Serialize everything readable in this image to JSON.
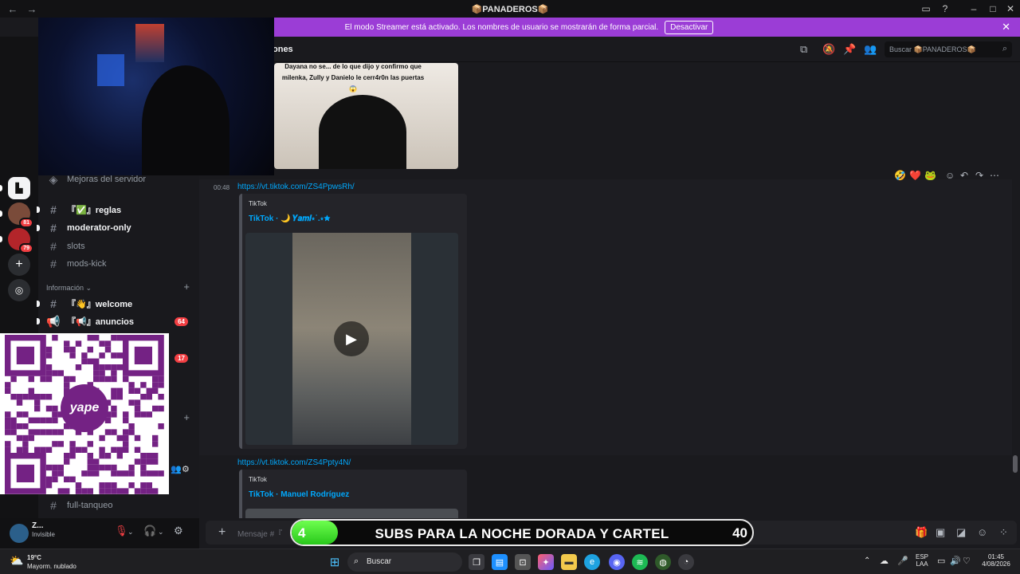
{
  "window": {
    "title": "📦PANADEROS📦",
    "back_icon": "←",
    "forward_icon": "→"
  },
  "banner": {
    "text": "El modo Streamer está activado. Los nombres de usuario se mostrarán de forma parcial.",
    "button": "Desactivar"
  },
  "header": {
    "title": "ones",
    "search_placeholder": "Buscar 📦PANADEROS📦"
  },
  "rail": {
    "badges": [
      "81",
      "79"
    ]
  },
  "sidebar": {
    "boosts": "Mejoras del servidor",
    "channels_top": [
      {
        "label": "『✅』reglas",
        "unread": true
      },
      {
        "label": "moderator-only",
        "unread": true
      },
      {
        "label": "slots",
        "unread": false
      },
      {
        "label": "mods-kick",
        "unread": false
      }
    ],
    "category": "Información",
    "channels_info": [
      {
        "label": "『👋』welcome",
        "unread": true
      },
      {
        "label": "『📢』anuncios",
        "unread": true,
        "badge": "64"
      }
    ],
    "hidden_badge": "17",
    "bottom_channel": "full-tanqueo"
  },
  "user": {
    "name": "Z...",
    "status": "Invisible"
  },
  "messages": {
    "first_video_caption": "Dayana no se... de lo que dijo y confirmo que milenka, Zully y Danielo le cerr4r0n las puertas 😱",
    "time": "00:48",
    "link1": "https://vt.tiktok.com/ZS4PpwsRh/",
    "embed1_provider": "TikTok",
    "embed1_title": "TikTok · 🌙 𝒀𝒂𝒎𝒊⋆˙.⋆✮",
    "link2": "https://vt.tiktok.com/ZS4Ppty4N/",
    "embed2_provider": "TikTok",
    "embed2_title": "TikTok · Manuel Rodríguez",
    "reactions": [
      "🤣",
      "❤️",
      "🐸"
    ]
  },
  "composer": {
    "placeholder": "Mensaje #『"
  },
  "overlay": {
    "subs_current": "4",
    "subs_text": "SUBS PARA LA NOCHE DORADA Y CARTEL",
    "subs_goal": "40",
    "subs_progress": 0.1,
    "qr_brand": "yape",
    "qr_brand_color": "#742284"
  },
  "taskbar": {
    "temp": "19°C",
    "weather": "Mayorm. nublado",
    "search": "Buscar",
    "lang1": "ESP",
    "lang2": "LAA",
    "time": "01:45",
    "date": "4/08/2026"
  }
}
